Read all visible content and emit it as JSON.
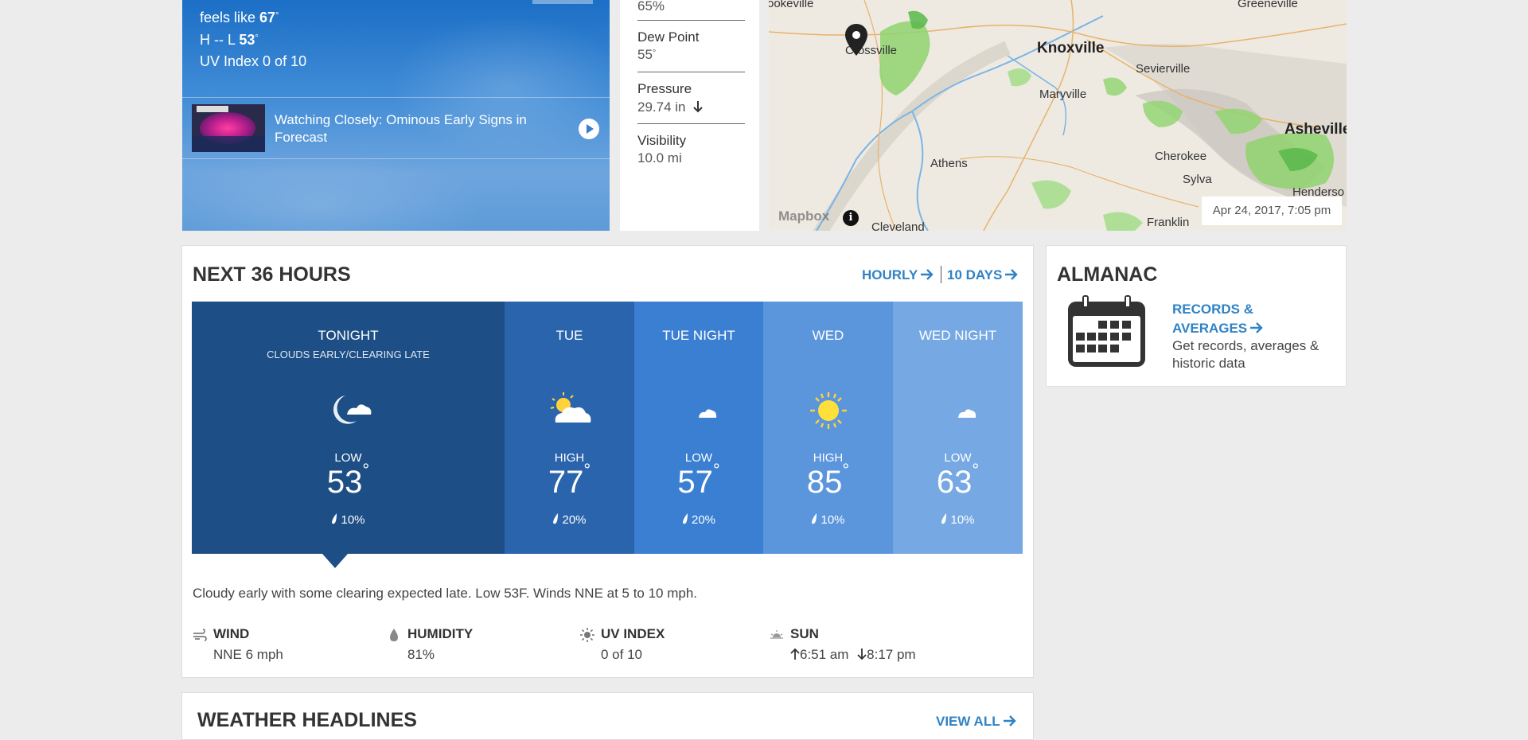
{
  "current": {
    "feels_like_label": "feels like",
    "feels_like_value": "67",
    "hl_label": "H -- L",
    "low_value": "53",
    "uv_text": "UV Index 0 of 10",
    "degree": "°"
  },
  "video": {
    "title": "Watching Closely: Ominous Early Signs in Forecast"
  },
  "details": {
    "humidity_value": "65%",
    "dew_point_label": "Dew Point",
    "dew_point_value": "55",
    "pressure_label": "Pressure",
    "pressure_value": "29.74 in",
    "visibility_label": "Visibility",
    "visibility_value": "10.0 mi"
  },
  "map": {
    "timestamp": "Apr 24, 2017, 7:05 pm",
    "attribution": "Mapbox",
    "info": "i",
    "places": {
      "brookeville": "ookeville",
      "greeneville": "Greeneville",
      "crossville": "Crossville",
      "knoxville": "Knoxville",
      "sevierville": "Sevierville",
      "maryville": "Maryville",
      "asheville": "Asheville",
      "cherokee": "Cherokee",
      "sylva": "Sylva",
      "athens": "Athens",
      "hendersonville": "Henderso",
      "franklin": "Franklin",
      "cleveland": "Cleveland"
    }
  },
  "next36": {
    "title": "NEXT 36 HOURS",
    "hourly_link": "HOURLY",
    "tenday_link": "10 DAYS",
    "periods": [
      {
        "name": "TONIGHT",
        "sub": "CLOUDS EARLY/CLEARING LATE",
        "hl": "LOW",
        "temp": "53",
        "precip": "10%",
        "icon": "night-cloudy-icon",
        "color": "#1d4e85"
      },
      {
        "name": "TUE",
        "sub": "",
        "hl": "HIGH",
        "temp": "77",
        "precip": "20%",
        "icon": "partly-cloudy-icon",
        "color": "#2a64ad"
      },
      {
        "name": "TUE NIGHT",
        "sub": "",
        "hl": "LOW",
        "temp": "57",
        "precip": "20%",
        "icon": "night-cloudy-icon",
        "color": "#3a7fd2"
      },
      {
        "name": "WED",
        "sub": "",
        "hl": "HIGH",
        "temp": "85",
        "precip": "10%",
        "icon": "sunny-icon",
        "color": "#5b96dd"
      },
      {
        "name": "WED NIGHT",
        "sub": "",
        "hl": "LOW",
        "temp": "63",
        "precip": "10%",
        "icon": "night-cloudy-icon",
        "color": "#76a9e3"
      }
    ],
    "narrative": "Cloudy early with some clearing expected late. Low 53F. Winds NNE at 5 to 10 mph.",
    "wind_label": "WIND",
    "wind_value": "NNE 6 mph",
    "humidity_label": "HUMIDITY",
    "humidity_value": "81%",
    "uv_label": "UV INDEX",
    "uv_value": "0 of 10",
    "sun_label": "SUN",
    "sunrise": "6:51 am",
    "sunset": "8:17 pm"
  },
  "almanac": {
    "title": "ALMANAC",
    "records_link": "RECORDS & AVERAGES",
    "description": "Get records, averages & historic data"
  },
  "headlines": {
    "title": "WEATHER HEADLINES",
    "view_all": "VIEW ALL"
  }
}
